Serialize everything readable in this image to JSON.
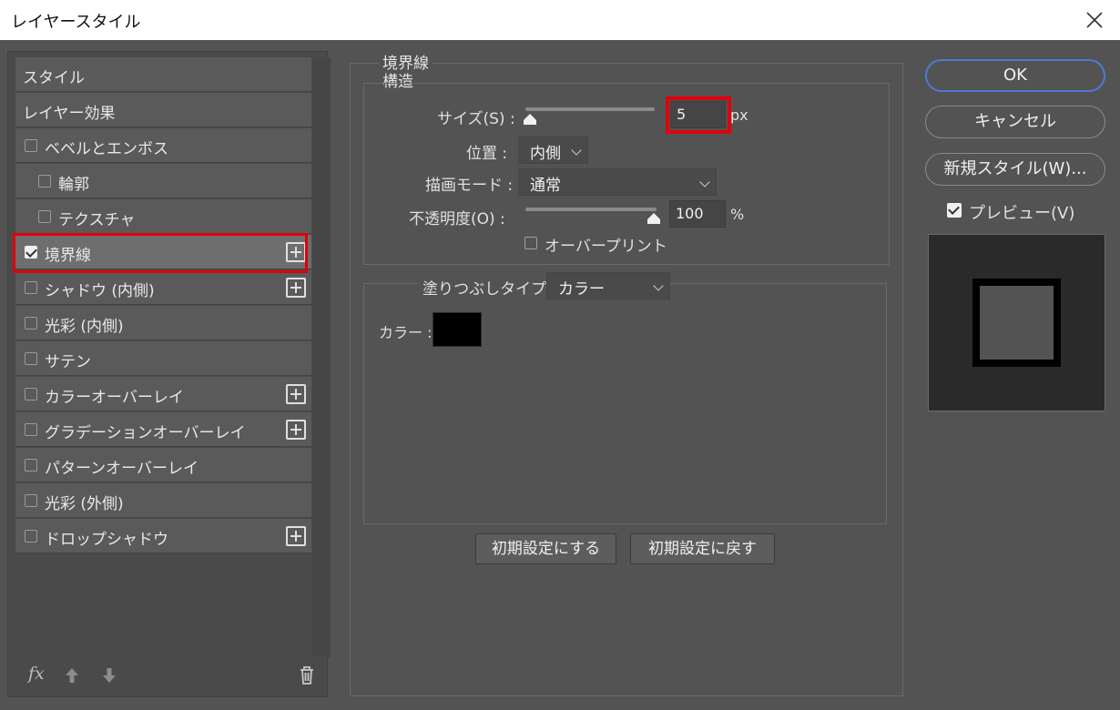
{
  "window": {
    "title": "レイヤースタイル"
  },
  "sidebar": {
    "items": [
      {
        "label": "スタイル",
        "checkbox": false,
        "checked": false,
        "plus": false,
        "indent": 0
      },
      {
        "label": "レイヤー効果",
        "checkbox": false,
        "checked": false,
        "plus": false,
        "indent": 0
      },
      {
        "label": "ベベルとエンボス",
        "checkbox": true,
        "checked": false,
        "plus": false,
        "indent": 0
      },
      {
        "label": "輪郭",
        "checkbox": true,
        "checked": false,
        "plus": false,
        "indent": 1
      },
      {
        "label": "テクスチャ",
        "checkbox": true,
        "checked": false,
        "plus": false,
        "indent": 1
      },
      {
        "label": "境界線",
        "checkbox": true,
        "checked": true,
        "plus": true,
        "indent": 0,
        "selected": true
      },
      {
        "label": "シャドウ (内側)",
        "checkbox": true,
        "checked": false,
        "plus": true,
        "indent": 0
      },
      {
        "label": "光彩 (内側)",
        "checkbox": true,
        "checked": false,
        "plus": false,
        "indent": 0
      },
      {
        "label": "サテン",
        "checkbox": true,
        "checked": false,
        "plus": false,
        "indent": 0
      },
      {
        "label": "カラーオーバーレイ",
        "checkbox": true,
        "checked": false,
        "plus": true,
        "indent": 0
      },
      {
        "label": "グラデーションオーバーレイ",
        "checkbox": true,
        "checked": false,
        "plus": true,
        "indent": 0
      },
      {
        "label": "パターンオーバーレイ",
        "checkbox": true,
        "checked": false,
        "plus": false,
        "indent": 0
      },
      {
        "label": "光彩 (外側)",
        "checkbox": true,
        "checked": false,
        "plus": false,
        "indent": 0
      },
      {
        "label": "ドロップシャドウ",
        "checkbox": true,
        "checked": false,
        "plus": true,
        "indent": 0
      }
    ],
    "footer": {
      "fx_label": "fx"
    }
  },
  "stroke": {
    "group_title": "境界線",
    "structure_title": "構造",
    "size_label": "サイズ(S) :",
    "size_value": "5",
    "size_unit": "px",
    "position_label": "位置 :",
    "position_value": "内側",
    "blend_label": "描画モード :",
    "blend_value": "通常",
    "opacity_label": "不透明度(O) :",
    "opacity_value": "100",
    "opacity_unit": "%",
    "overprint_label": "オーバープリント",
    "fill_type_label": "塗りつぶしタイプ :",
    "fill_type_value": "カラー",
    "color_label": "カラー :",
    "color_value": "#000000",
    "make_default_label": "初期設定にする",
    "reset_default_label": "初期設定に戻す"
  },
  "actions": {
    "ok_label": "OK",
    "cancel_label": "キャンセル",
    "new_style_label": "新規スタイル(W)...",
    "preview_label": "プレビュー(V)"
  },
  "colors": {
    "accent": "#4d7ad6",
    "highlight": "#e0000a"
  }
}
